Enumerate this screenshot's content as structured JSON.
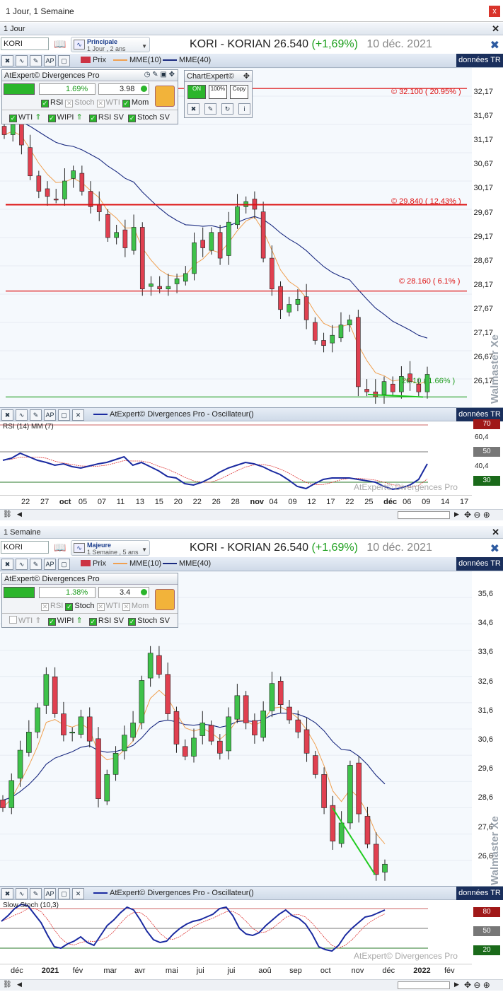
{
  "window": {
    "title": "1 Jour, 1 Semaine",
    "close_glyph": "x"
  },
  "top": {
    "pane_title": "1 Jour",
    "symbol": "KORI",
    "preset_name": "Principale",
    "preset_sub": "1 Jour , 2 ans",
    "quote_title": "KORI - KORIAN",
    "price": "26.540",
    "change": "(+1,69%)",
    "date": "10 déc. 2021",
    "legend": [
      {
        "label": "Prix",
        "color": "#cc3344"
      },
      {
        "label": "MME(10)",
        "color": "#f0a050"
      },
      {
        "label": "MME(40)",
        "color": "#1a2a80"
      }
    ],
    "donnees": "données TR",
    "watermark": "Walmaster Xe",
    "expert": {
      "title": "AtExpert© Divergences Pro",
      "pct": "1.69%",
      "rs_value": "3.98",
      "checks": [
        {
          "label": "RSI",
          "on": true
        },
        {
          "label": "Stoch",
          "on": false
        },
        {
          "label": "WTI",
          "on": false
        },
        {
          "label": "Mom",
          "on": true
        }
      ],
      "row3": [
        {
          "label": "WTI",
          "on": true
        },
        {
          "label": "WIPI",
          "on": true
        },
        {
          "label": "RSI SV",
          "on": true
        },
        {
          "label": "Stoch SV",
          "on": true
        }
      ]
    },
    "chartexpert": {
      "title": "ChartExpert©",
      "b1": "ON",
      "b2": "100%",
      "b3": "Copy"
    },
    "yticks": [
      "32,17",
      "31,67",
      "31,17",
      "30,67",
      "30,17",
      "29,67",
      "29,17",
      "28,67",
      "28,17",
      "27,67",
      "27,17",
      "26,67",
      "26,17"
    ],
    "levels": [
      {
        "text": "© 32.100 ( 20.95% )",
        "color": "#d11"
      },
      {
        "text": "© 29.840 ( 12.43% )",
        "color": "#d11"
      },
      {
        "text": "© 28.160 ( 6.1% )",
        "color": "#d11"
      },
      {
        "text": "26.10 ( 1.66% )",
        "color": "#1a9a1a"
      }
    ],
    "osc_title": "AtExpert© Divergences Pro - Oscillateur()",
    "osc_label": "RSI (14) MM (7)",
    "osc_ticks": [
      "70",
      "60,4",
      "50",
      "40,4",
      "30"
    ],
    "osc_watermark": "AtExpert© Divergences Pro",
    "xlabels": [
      {
        "t": "22",
        "b": false
      },
      {
        "t": "27",
        "b": false
      },
      {
        "t": "oct",
        "b": true
      },
      {
        "t": "05",
        "b": false
      },
      {
        "t": "07",
        "b": false
      },
      {
        "t": "11",
        "b": false
      },
      {
        "t": "13",
        "b": false
      },
      {
        "t": "15",
        "b": false
      },
      {
        "t": "20",
        "b": false
      },
      {
        "t": "22",
        "b": false
      },
      {
        "t": "26",
        "b": false
      },
      {
        "t": "28",
        "b": false
      },
      {
        "t": "nov",
        "b": true
      },
      {
        "t": "04",
        "b": false
      },
      {
        "t": "09",
        "b": false
      },
      {
        "t": "12",
        "b": false
      },
      {
        "t": "17",
        "b": false
      },
      {
        "t": "22",
        "b": false
      },
      {
        "t": "25",
        "b": false
      },
      {
        "t": "déc",
        "b": true
      },
      {
        "t": "06",
        "b": false
      },
      {
        "t": "09",
        "b": false
      },
      {
        "t": "14",
        "b": false
      },
      {
        "t": "17",
        "b": false
      }
    ]
  },
  "bottom": {
    "pane_title": "1 Semaine",
    "symbol": "KORI",
    "preset_name": "Majeure",
    "preset_sub": "1 Semaine , 5 ans",
    "quote_title": "KORI - KORIAN",
    "price": "26.540",
    "change": "(+1,69%)",
    "date": "10 déc. 2021",
    "legend": [
      {
        "label": "Prix",
        "color": "#cc3344"
      },
      {
        "label": "MME(10)",
        "color": "#f0a050"
      },
      {
        "label": "MME(40)",
        "color": "#1a2a80"
      }
    ],
    "donnees": "données TR",
    "watermark": "Walmaster Xe",
    "expert": {
      "title": "AtExpert© Divergences Pro",
      "pct": "1.38%",
      "rs_value": "3.4",
      "checks": [
        {
          "label": "RSI",
          "on": false
        },
        {
          "label": "Stoch",
          "on": true
        },
        {
          "label": "WTI",
          "on": false
        },
        {
          "label": "Mom",
          "on": false
        }
      ],
      "row3": [
        {
          "label": "WTI",
          "on": false
        },
        {
          "label": "WIPI",
          "on": true
        },
        {
          "label": "RSI SV",
          "on": true
        },
        {
          "label": "Stoch SV",
          "on": true
        }
      ]
    },
    "yticks": [
      "35,6",
      "34,6",
      "33,6",
      "32,6",
      "31,6",
      "30,6",
      "29,6",
      "28,6",
      "27,6",
      "26,6"
    ],
    "osc_title": "AtExpert© Divergences Pro - Oscillateur()",
    "osc_label": "Slow Stoch (10,3)",
    "osc_ticks": [
      "80",
      "50",
      "20"
    ],
    "osc_watermark": "AtExpert© Divergences Pro",
    "xlabels": [
      {
        "t": "déc",
        "b": false
      },
      {
        "t": "2021",
        "b": true
      },
      {
        "t": "fév",
        "b": false
      },
      {
        "t": "mar",
        "b": false
      },
      {
        "t": "avr",
        "b": false
      },
      {
        "t": "mai",
        "b": false
      },
      {
        "t": "jui",
        "b": false
      },
      {
        "t": "jui",
        "b": false
      },
      {
        "t": "aoû",
        "b": false
      },
      {
        "t": "sep",
        "b": false
      },
      {
        "t": "oct",
        "b": false
      },
      {
        "t": "nov",
        "b": false
      },
      {
        "t": "déc",
        "b": false
      },
      {
        "t": "2022",
        "b": true
      },
      {
        "t": "fév",
        "b": false
      }
    ]
  },
  "chart_data": [
    {
      "type": "candlestick",
      "timeframe": "1 Jour",
      "ylim": [
        25.9,
        32.5
      ],
      "closes": [
        31.2,
        31.4,
        31.0,
        30.4,
        30.1,
        30.0,
        29.95,
        30.3,
        30.5,
        30.1,
        29.8,
        29.7,
        29.2,
        29.3,
        29.0,
        29.4,
        28.2,
        28.3,
        28.2,
        28.25,
        28.4,
        28.5,
        29.1,
        29.0,
        29.3,
        28.8,
        29.5,
        29.8,
        29.9,
        29.75,
        28.8,
        28.2,
        27.8,
        27.9,
        28.0,
        27.6,
        27.2,
        27.1,
        27.3,
        27.5,
        27.6,
        26.3,
        26.2,
        26.1,
        26.4,
        26.2,
        26.5,
        26.4,
        26.2,
        26.54
      ],
      "mme10_end": 26.55,
      "mme40_end": 27.7,
      "levels": [
        32.1,
        29.84,
        28.16,
        26.1
      ]
    },
    {
      "type": "candlestick",
      "timeframe": "1 Semaine",
      "ylim": [
        25.8,
        36.2
      ],
      "closes": [
        28.4,
        29.3,
        30.3,
        30.9,
        31.7,
        32.8,
        31.5,
        30.8,
        30.9,
        31.4,
        30.6,
        28.7,
        29.5,
        30.2,
        30.8,
        31.2,
        32.6,
        33.5,
        32.8,
        31.5,
        30.5,
        30.1,
        30.7,
        31.2,
        30.6,
        30.2,
        31.4,
        32.1,
        31.2,
        30.8,
        31.6,
        32.5,
        31.8,
        31.3,
        30.9,
        30.2,
        29.5,
        28.4,
        27.3,
        27.9,
        29.8,
        28.2,
        27.2,
        26.2,
        26.54
      ],
      "mme10_end": 27.8,
      "mme40_end": 29.7
    }
  ]
}
